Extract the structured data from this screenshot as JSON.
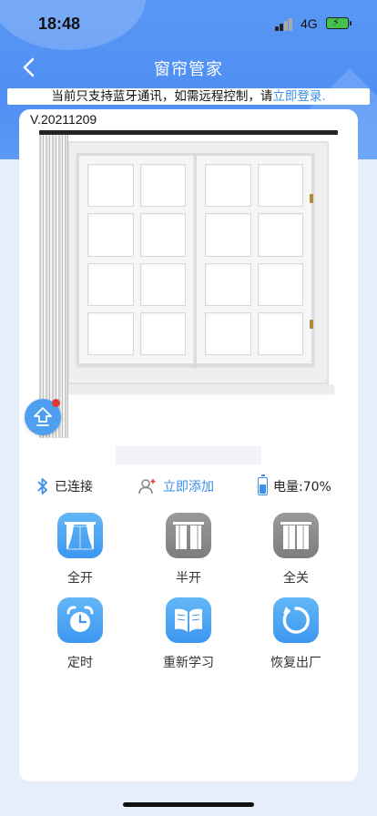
{
  "status_bar": {
    "time": "18:48",
    "network": "4G",
    "battery_charging": true
  },
  "nav": {
    "title": "窗帘管家"
  },
  "notice": {
    "text": "当前只支持蓝牙通讯，如需远程控制，请",
    "link": "立即登录."
  },
  "device": {
    "version": "V.20211209"
  },
  "status": {
    "connection": "已连接",
    "add_label": "立即添加",
    "battery_label": "电量:70%",
    "battery_level": 0.7
  },
  "actions": [
    {
      "label": "全开",
      "icon": "curtain-open-icon",
      "style": "blue"
    },
    {
      "label": "半开",
      "icon": "curtain-half-icon",
      "style": "gray"
    },
    {
      "label": "全关",
      "icon": "curtain-close-icon",
      "style": "gray"
    },
    {
      "label": "定时",
      "icon": "alarm-clock-icon",
      "style": "blue"
    },
    {
      "label": "重新学习",
      "icon": "book-icon",
      "style": "blue"
    },
    {
      "label": "恢复出厂",
      "icon": "restore-icon",
      "style": "blue"
    }
  ],
  "colors": {
    "accent": "#3b8fe8",
    "header": "#5a98f5",
    "gray_button": "#8a8a8a"
  }
}
